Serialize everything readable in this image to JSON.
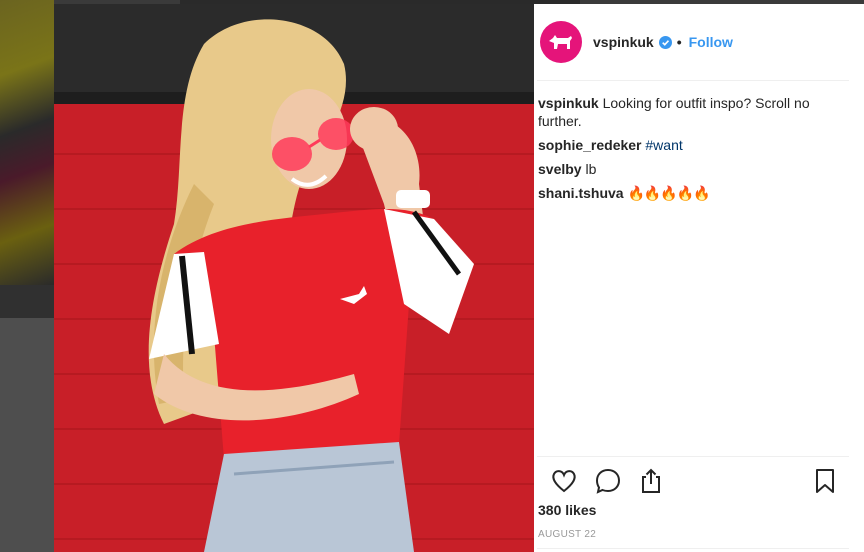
{
  "post": {
    "username": "vspinkuk",
    "separator": "•",
    "follow_label": "Follow",
    "comments": [
      {
        "user": "vspinkuk",
        "text": "Looking for outfit inspo? Scroll no further."
      },
      {
        "user": "sophie_redeker",
        "text": "",
        "tag": "#want"
      },
      {
        "user": "svelby",
        "text": "lb"
      },
      {
        "user": "shani.tshuva",
        "text": "🔥🔥🔥🔥🔥"
      }
    ],
    "likes": "380 likes",
    "date": "AUGUST 22"
  },
  "icons": {
    "avatar": "pink-dog-logo-icon",
    "verified": "verified-badge-icon",
    "like": "heart-icon",
    "comment": "comment-bubble-icon",
    "share": "share-icon",
    "save": "bookmark-icon"
  },
  "colors": {
    "accent": "#3897f0",
    "brand_pink": "#e5147a",
    "text": "#262626",
    "muted": "#999999",
    "hashtag": "#003569"
  }
}
